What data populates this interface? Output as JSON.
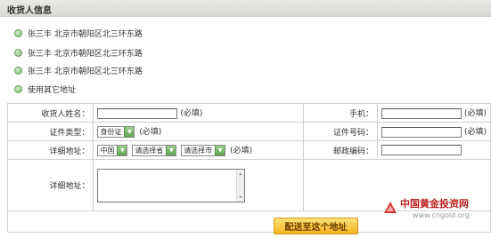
{
  "header": {
    "title": "收货人信息"
  },
  "address_options": [
    {
      "label": "张三丰 北京市朝阳区北三环东路"
    },
    {
      "label": "张三丰 北京市朝阳区北三环东路"
    },
    {
      "label": "张三丰 北京市朝阳区北三环东路"
    },
    {
      "label": "使用其它地址"
    }
  ],
  "form": {
    "name_label": "收货人姓名：",
    "name_value": "",
    "required": "(必填)",
    "mobile_label": "手机：",
    "mobile_value": "",
    "id_type_label": "证件类型：",
    "id_type_value": "身份证",
    "id_number_label": "证件号码：",
    "id_number_value": "",
    "address_label": "详细地址：",
    "country_value": "中国",
    "province_value": "请选择省",
    "city_value": "请选择市",
    "zip_label": "邮政编码：",
    "zip_value": "",
    "address_detail_label": "详细地址：",
    "address_detail_value": ""
  },
  "submit_button": {
    "label": "配送至这个地址"
  },
  "watermark": {
    "cn": "中国黄金投资网",
    "url": "www.cngold.org"
  }
}
